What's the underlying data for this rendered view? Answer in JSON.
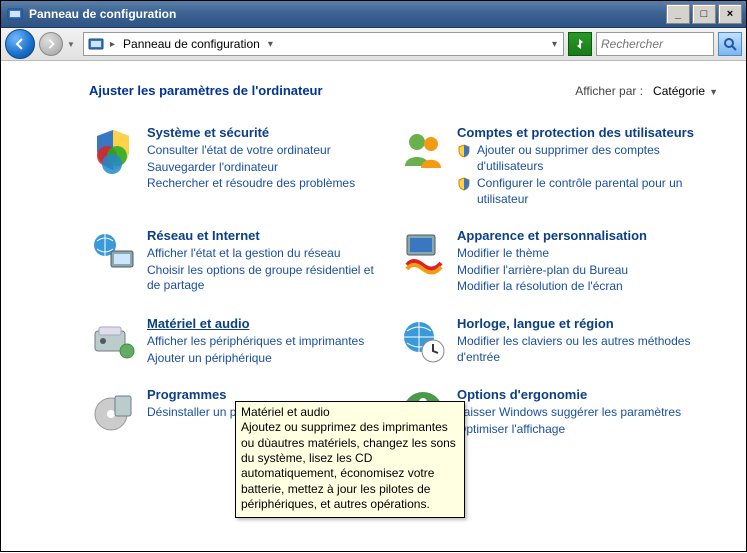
{
  "window": {
    "title": "Panneau de configuration"
  },
  "nav": {
    "breadcrumb": "Panneau de configuration",
    "search_placeholder": "Rechercher"
  },
  "header": {
    "title": "Ajuster les paramètres de l'ordinateur",
    "view_by_label": "Afficher par :",
    "view_by_value": "Catégorie"
  },
  "categories": {
    "left": [
      {
        "title": "Système et sécurité",
        "subs": [
          "Consulter l'état de votre ordinateur",
          "Sauvegarder l'ordinateur",
          "Rechercher et résoudre des problèmes"
        ]
      },
      {
        "title": "Réseau et Internet",
        "subs": [
          "Afficher l'état et la gestion du réseau",
          "Choisir les options de groupe résidentiel et de partage"
        ]
      },
      {
        "title": "Matériel et audio",
        "underline": true,
        "subs": [
          "Afficher les périphériques et imprimantes",
          "Ajouter un périphérique"
        ]
      },
      {
        "title": "Programmes",
        "subs": [
          "Désinstaller un programme"
        ]
      }
    ],
    "right": [
      {
        "title": "Comptes et protection des utilisateurs",
        "shielded_subs": [
          "Ajouter ou supprimer des comptes d'utilisateurs",
          "Configurer le contrôle parental pour un utilisateur"
        ]
      },
      {
        "title": "Apparence et personnalisation",
        "subs": [
          "Modifier le thème",
          "Modifier l'arrière-plan du Bureau",
          "Modifier la résolution de l'écran"
        ]
      },
      {
        "title": "Horloge, langue et région",
        "subs": [
          "Modifier les claviers ou les autres méthodes d'entrée"
        ]
      },
      {
        "title": "Options d'ergonomie",
        "subs": [
          "Laisser Windows suggérer les paramètres",
          "Optimiser l'affichage"
        ]
      }
    ]
  },
  "tooltip": {
    "title": "Matériel et audio",
    "body": "Ajoutez ou supprimez des imprimantes ou dùautres matériels, changez les sons du système, lisez les CD automatiquement, économisez votre batterie, mettez à jour les pilotes de périphériques, et autres opérations."
  }
}
